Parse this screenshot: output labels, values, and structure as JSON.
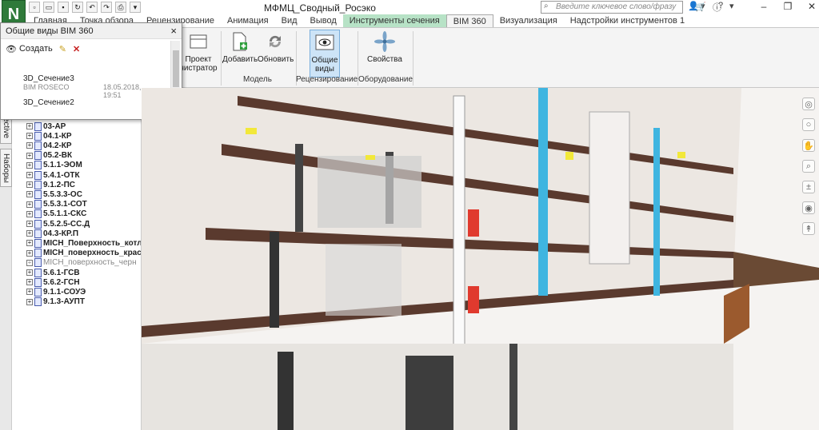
{
  "app": {
    "logo": "N",
    "window_title": "МФМЦ_Сводный_Росэко",
    "search_placeholder": "Введите ключевое слово/фразу"
  },
  "tabs": [
    "Главная",
    "Точка обзора",
    "Рецензирование",
    "Анимация",
    "Вид",
    "Вывод",
    "Инструменты сечения",
    "BIM 360",
    "Визуализация",
    "Надстройки инструментов 1"
  ],
  "ribbon": {
    "project_admin": "Проект\nнистратор",
    "add_label": "Добавить",
    "update_label": "Обновить",
    "shared_views_label": "Общие\nвиды",
    "properties_label": "Свойства",
    "groups": {
      "model": "Модель",
      "review": "Рецензирование",
      "equipment": "Оборудование"
    }
  },
  "popup": {
    "title": "Общие виды BIM 360",
    "create_label": "Создать",
    "entries": [
      {
        "name": "3D_Сечение3",
        "author": "BIM ROSECO",
        "date": "18.05.2018, 19:51"
      },
      {
        "name": "3D_Сечение2",
        "author": "",
        "date": ""
      }
    ]
  },
  "left_tabs": {
    "perspective": "ective",
    "sets": "Наборы"
  },
  "tree": [
    {
      "label": "03-АР",
      "dim": false
    },
    {
      "label": "04.1-КР",
      "dim": false
    },
    {
      "label": "04.2-КР",
      "dim": false
    },
    {
      "label": "05.2-ВК",
      "dim": false
    },
    {
      "label": "5.1.1-ЭОМ",
      "dim": false
    },
    {
      "label": "5.4.1-ОТК",
      "dim": false
    },
    {
      "label": "9.1.2-ПС",
      "dim": false
    },
    {
      "label": "5.5.3.3-ОС",
      "dim": false
    },
    {
      "label": "5.5.3.1-СОТ",
      "dim": false
    },
    {
      "label": "5.5.1.1-СКС",
      "dim": false
    },
    {
      "label": "5.5.2.5-СС.Д",
      "dim": false
    },
    {
      "label": "04.3-КР.П",
      "dim": false
    },
    {
      "label": "MICH_Поверхность_котл",
      "dim": false
    },
    {
      "label": "MICH_поверхность_крас",
      "dim": false
    },
    {
      "label": "MICH_поверхность_черн",
      "dim": true
    },
    {
      "label": "5.6.1-ГСВ",
      "dim": false
    },
    {
      "label": "5.6.2-ГСН",
      "dim": false
    },
    {
      "label": "9.1.1-СОУЭ",
      "dim": false
    },
    {
      "label": "9.1.3-АУПТ",
      "dim": false
    }
  ],
  "colors": {
    "context_tab": "#b7e2c6",
    "slab": "#5a3a2e",
    "duct": "#3fb5e0",
    "red_panel": "#e03a2e",
    "yellow": "#f2e83a"
  },
  "icons": {
    "search": "magnifier-icon",
    "help": "question-icon",
    "cart": "cart-icon"
  }
}
